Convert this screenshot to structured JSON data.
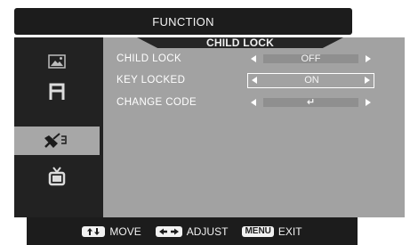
{
  "header": {
    "title": "FUNCTION"
  },
  "sidebar": {
    "items": [
      {
        "icon": "picture-icon",
        "active": false
      },
      {
        "icon": "audio-icon",
        "active": false
      },
      {
        "icon": "function-icon",
        "active": true
      },
      {
        "icon": "tv-icon",
        "active": false
      }
    ]
  },
  "panel": {
    "title": "CHILD LOCK",
    "rows": [
      {
        "label": "CHILD LOCK",
        "value": "OFF",
        "focused": false
      },
      {
        "label": "KEY LOCKED",
        "value": "ON",
        "focused": true
      },
      {
        "label": "CHANGE CODE",
        "value": "↵",
        "focused": false
      }
    ]
  },
  "footer": {
    "move_label": "MOVE",
    "adjust_label": "ADJUST",
    "menu_key": "MENU",
    "exit_label": "EXIT",
    "move_key_icon": "up-down-arrows-icon",
    "adjust_key_icon": "left-right-arrows-icon"
  },
  "colors": {
    "bar": "#1c1c1c",
    "panel": "#a2a2a2",
    "sidebar": "#222222",
    "active_item": "#a7a7a7",
    "value_box": "#8f8f8f",
    "text": "#ffffff"
  }
}
